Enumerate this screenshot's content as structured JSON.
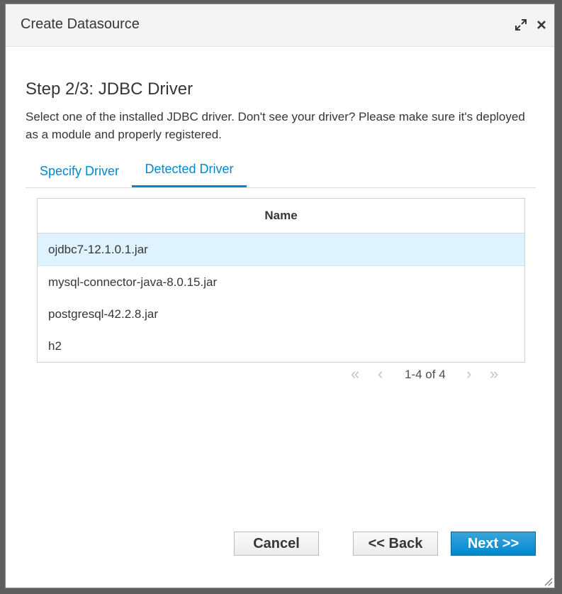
{
  "dialog": {
    "title": "Create Datasource",
    "step_title": "Step 2/3: JDBC Driver",
    "description": "Select one of the installed JDBC driver. Don't see your driver? Please make sure it's deployed as a module and properly registered."
  },
  "tabs": [
    {
      "label": "Specify Driver",
      "active": false
    },
    {
      "label": "Detected Driver",
      "active": true
    }
  ],
  "table": {
    "header": "Name",
    "rows": [
      {
        "name": "ojdbc7-12.1.0.1.jar",
        "selected": true
      },
      {
        "name": "mysql-connector-java-8.0.15.jar",
        "selected": false
      },
      {
        "name": "postgresql-42.2.8.jar",
        "selected": false
      },
      {
        "name": "h2",
        "selected": false
      }
    ]
  },
  "pager": {
    "info": "1-4 of 4",
    "first": "«",
    "prev": "‹",
    "next": "›",
    "last": "»"
  },
  "buttons": {
    "cancel": "Cancel",
    "back": "<< Back",
    "next": "Next >>"
  },
  "icons": {
    "maximize": "maximize-icon",
    "close": "close-icon",
    "resize": "resize-grip-icon"
  },
  "colors": {
    "accent": "#0088ce",
    "selected_row": "#def3ff"
  }
}
